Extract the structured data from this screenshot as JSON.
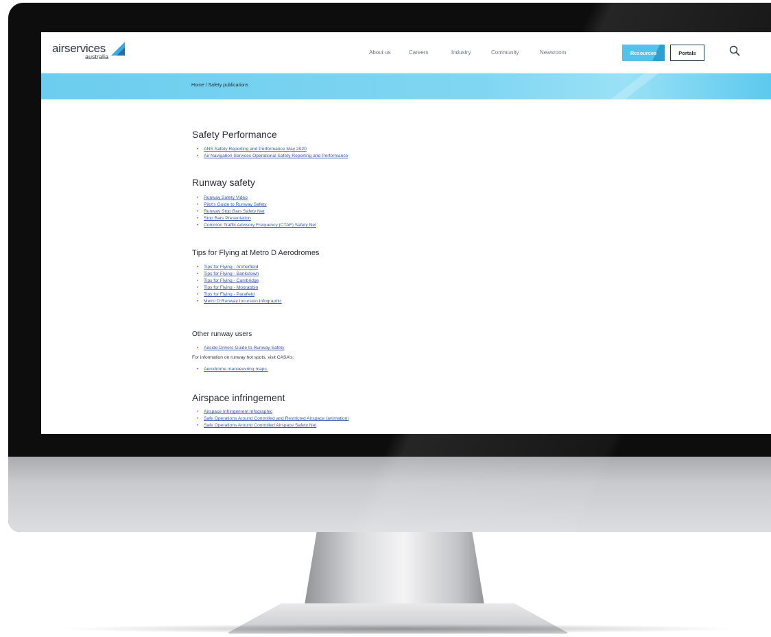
{
  "header": {
    "logo_main": "airservices",
    "logo_sub": "australia",
    "nav": [
      "About us",
      "Careers",
      "Industry",
      "Community",
      "Newsroom"
    ],
    "resources_label": "Resources",
    "portals_label": "Portals",
    "search_icon": "search-icon"
  },
  "breadcrumb": "Home / Safety publications",
  "sections": {
    "safety_performance": {
      "title": "Safety Performance",
      "links": [
        "ANS Safety Reporting and Performance May 2020",
        "Air Navigation Services Operational Safety Reporting and Performance"
      ]
    },
    "runway_safety": {
      "title": "Runway safety",
      "links": [
        "Runway Safety Video",
        "Pilot's Guide to Runway Safety",
        "Runway Stop Bars Safety Net",
        "Stop Bars Presentation",
        "Common Traffic Advisory Frequency (CTAF) Safety Net"
      ]
    },
    "tips_metro_d": {
      "title": "Tips for Flying at Metro D Aerodromes",
      "links": [
        "Tips for Flying - Archerfield",
        "Tips for Flying - Bankstown",
        "Tips for Flying - Cambridge",
        "Tips for Flying - Moorabbin",
        "Tips for Flying - Parafield",
        "Metro D Runway Incursion Infographic"
      ]
    },
    "other_runway_users": {
      "title": "Other runway users",
      "links": [
        "Airside Drivers Guide to Runway Safety"
      ],
      "note": "For information on runway hot spots, visit CASA's:",
      "note_links": [
        "Aerodrome manoeuvring maps."
      ]
    },
    "airspace_infringement": {
      "title": "Airspace infringement",
      "links": [
        "Airspace Infringement Infographic",
        "Safe Operations Around Controlled and Restricted Airspace (animation)",
        "Safe Operations Around Controlled Airspace Safety Net"
      ]
    }
  }
}
